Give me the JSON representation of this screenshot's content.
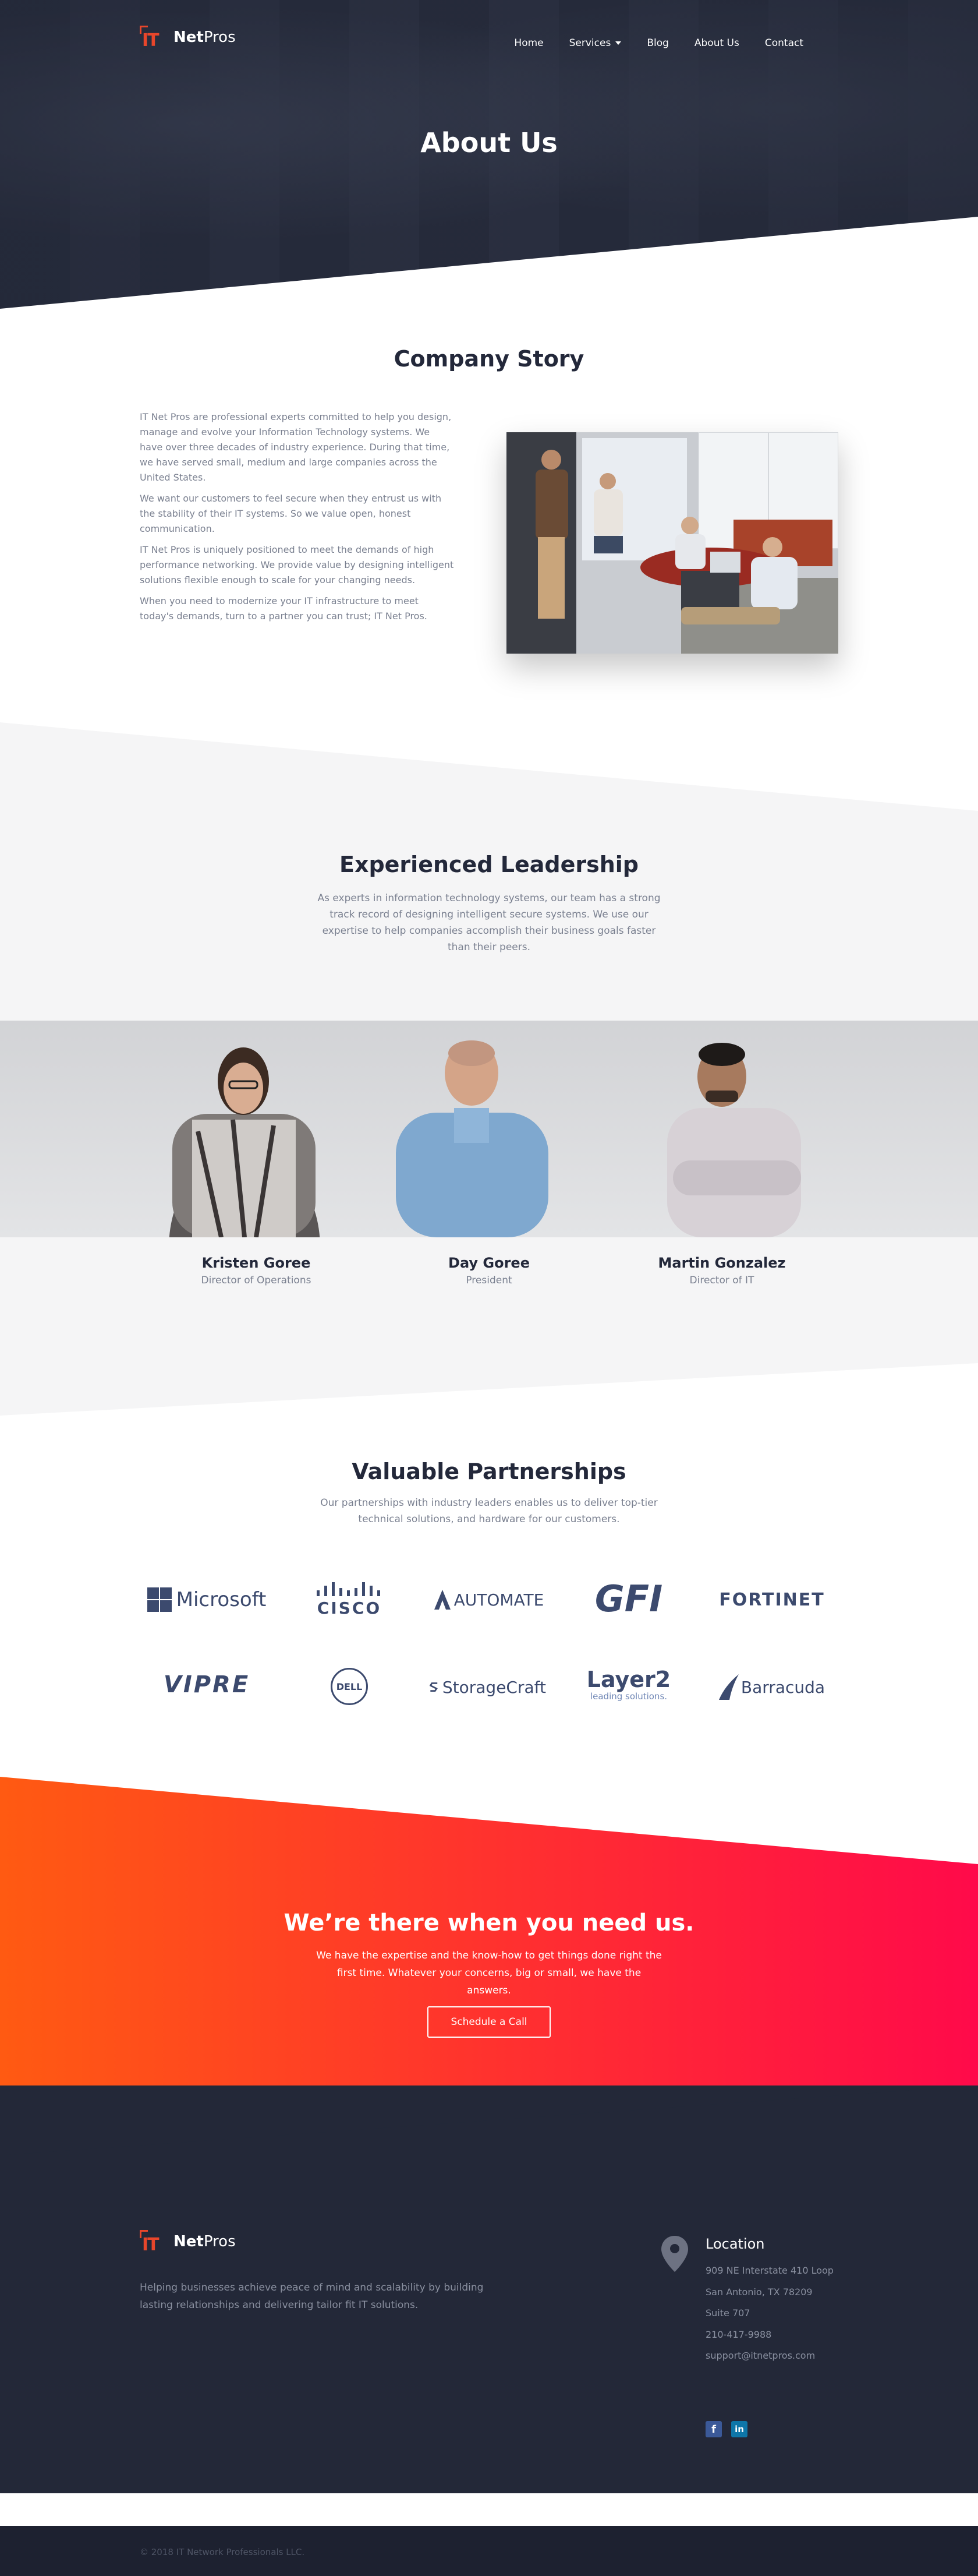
{
  "brand": {
    "logo_mark": "IT",
    "logo_word_bold": "Net",
    "logo_word": "Pros",
    "accent": "#e8462b",
    "dark": "#232838"
  },
  "nav": {
    "items": [
      {
        "label": "Home"
      },
      {
        "label": "Services",
        "has_dropdown": true
      },
      {
        "label": "Blog"
      },
      {
        "label": "About Us"
      },
      {
        "label": "Contact"
      }
    ]
  },
  "hero": {
    "title": "About Us"
  },
  "story": {
    "title": "Company Story",
    "paragraphs": [
      "IT Net Pros are professional experts committed to help you design, manage and evolve your Information Technology systems. We have over three decades of industry experience. During that time, we have served small, medium and large companies across the United States.",
      "We want our customers to feel secure when they entrust us with the stability of their IT systems. So we value open, honest communication.",
      "IT Net Pros is uniquely positioned to meet the demands of high performance networking. We provide value by designing intelligent solutions flexible enough to scale for your changing needs.",
      "When you need to modernize your IT infrastructure to meet today's demands, turn to a partner you can trust; IT Net Pros."
    ]
  },
  "leadership": {
    "title": "Experienced Leadership",
    "subtitle": "As experts in information technology systems, our team has a strong track record of designing intelligent secure systems. We use our expertise to help companies accomplish their business goals faster than their peers.",
    "members": [
      {
        "name": "Kristen Goree",
        "role": "Director of Operations"
      },
      {
        "name": "Day Goree",
        "role": "President"
      },
      {
        "name": "Martin Gonzalez",
        "role": "Director of IT"
      }
    ]
  },
  "partnerships": {
    "title": "Valuable Partnerships",
    "subtitle": "Our partnerships with industry leaders enables us to deliver top-tier technical solutions, and hardware for our customers.",
    "logos": [
      {
        "name": "Microsoft",
        "icon": "microsoft-logo"
      },
      {
        "name": "CISCO",
        "icon": "cisco-logo"
      },
      {
        "name": "AUTOMATE",
        "icon": "automate-logo"
      },
      {
        "name": "GFI",
        "icon": "gfi-logo"
      },
      {
        "name": "FORTINET",
        "icon": "fortinet-logo"
      },
      {
        "name": "VIPRE",
        "icon": "vipre-logo"
      },
      {
        "name": "DELL",
        "icon": "dell-logo"
      },
      {
        "name": "StorageCraft",
        "icon": "storagecraft-logo"
      },
      {
        "name": "Layer2",
        "tagline": "leading solutions.",
        "icon": "layer2-logo"
      },
      {
        "name": "Barracuda",
        "icon": "barracuda-logo"
      }
    ]
  },
  "cta": {
    "title": "We’re there when you need us.",
    "subtitle": "We have the expertise and the know-how to get things done right the first time. Whatever your concerns, big or small, we have the answers.",
    "button": "Schedule a Call",
    "gradient_start": "#ff5a12",
    "gradient_end": "#ff0a4a"
  },
  "footer": {
    "tagline": "Helping businesses achieve peace of mind and scalability by building lasting relationships and delivering tailor fit IT solutions.",
    "location_title": "Location",
    "address_lines": [
      "909 NE Interstate 410 Loop",
      "San Antonio, TX 78209",
      "Suite 707",
      "210-417-9988",
      "support@itnetpros.com"
    ],
    "social": [
      {
        "label": "f",
        "icon": "facebook-icon",
        "color": "#3b5998"
      },
      {
        "label": "in",
        "icon": "linkedin-icon",
        "color": "#0e76a8"
      }
    ],
    "copyright": "© 2018 IT Network Professionals LLC."
  }
}
